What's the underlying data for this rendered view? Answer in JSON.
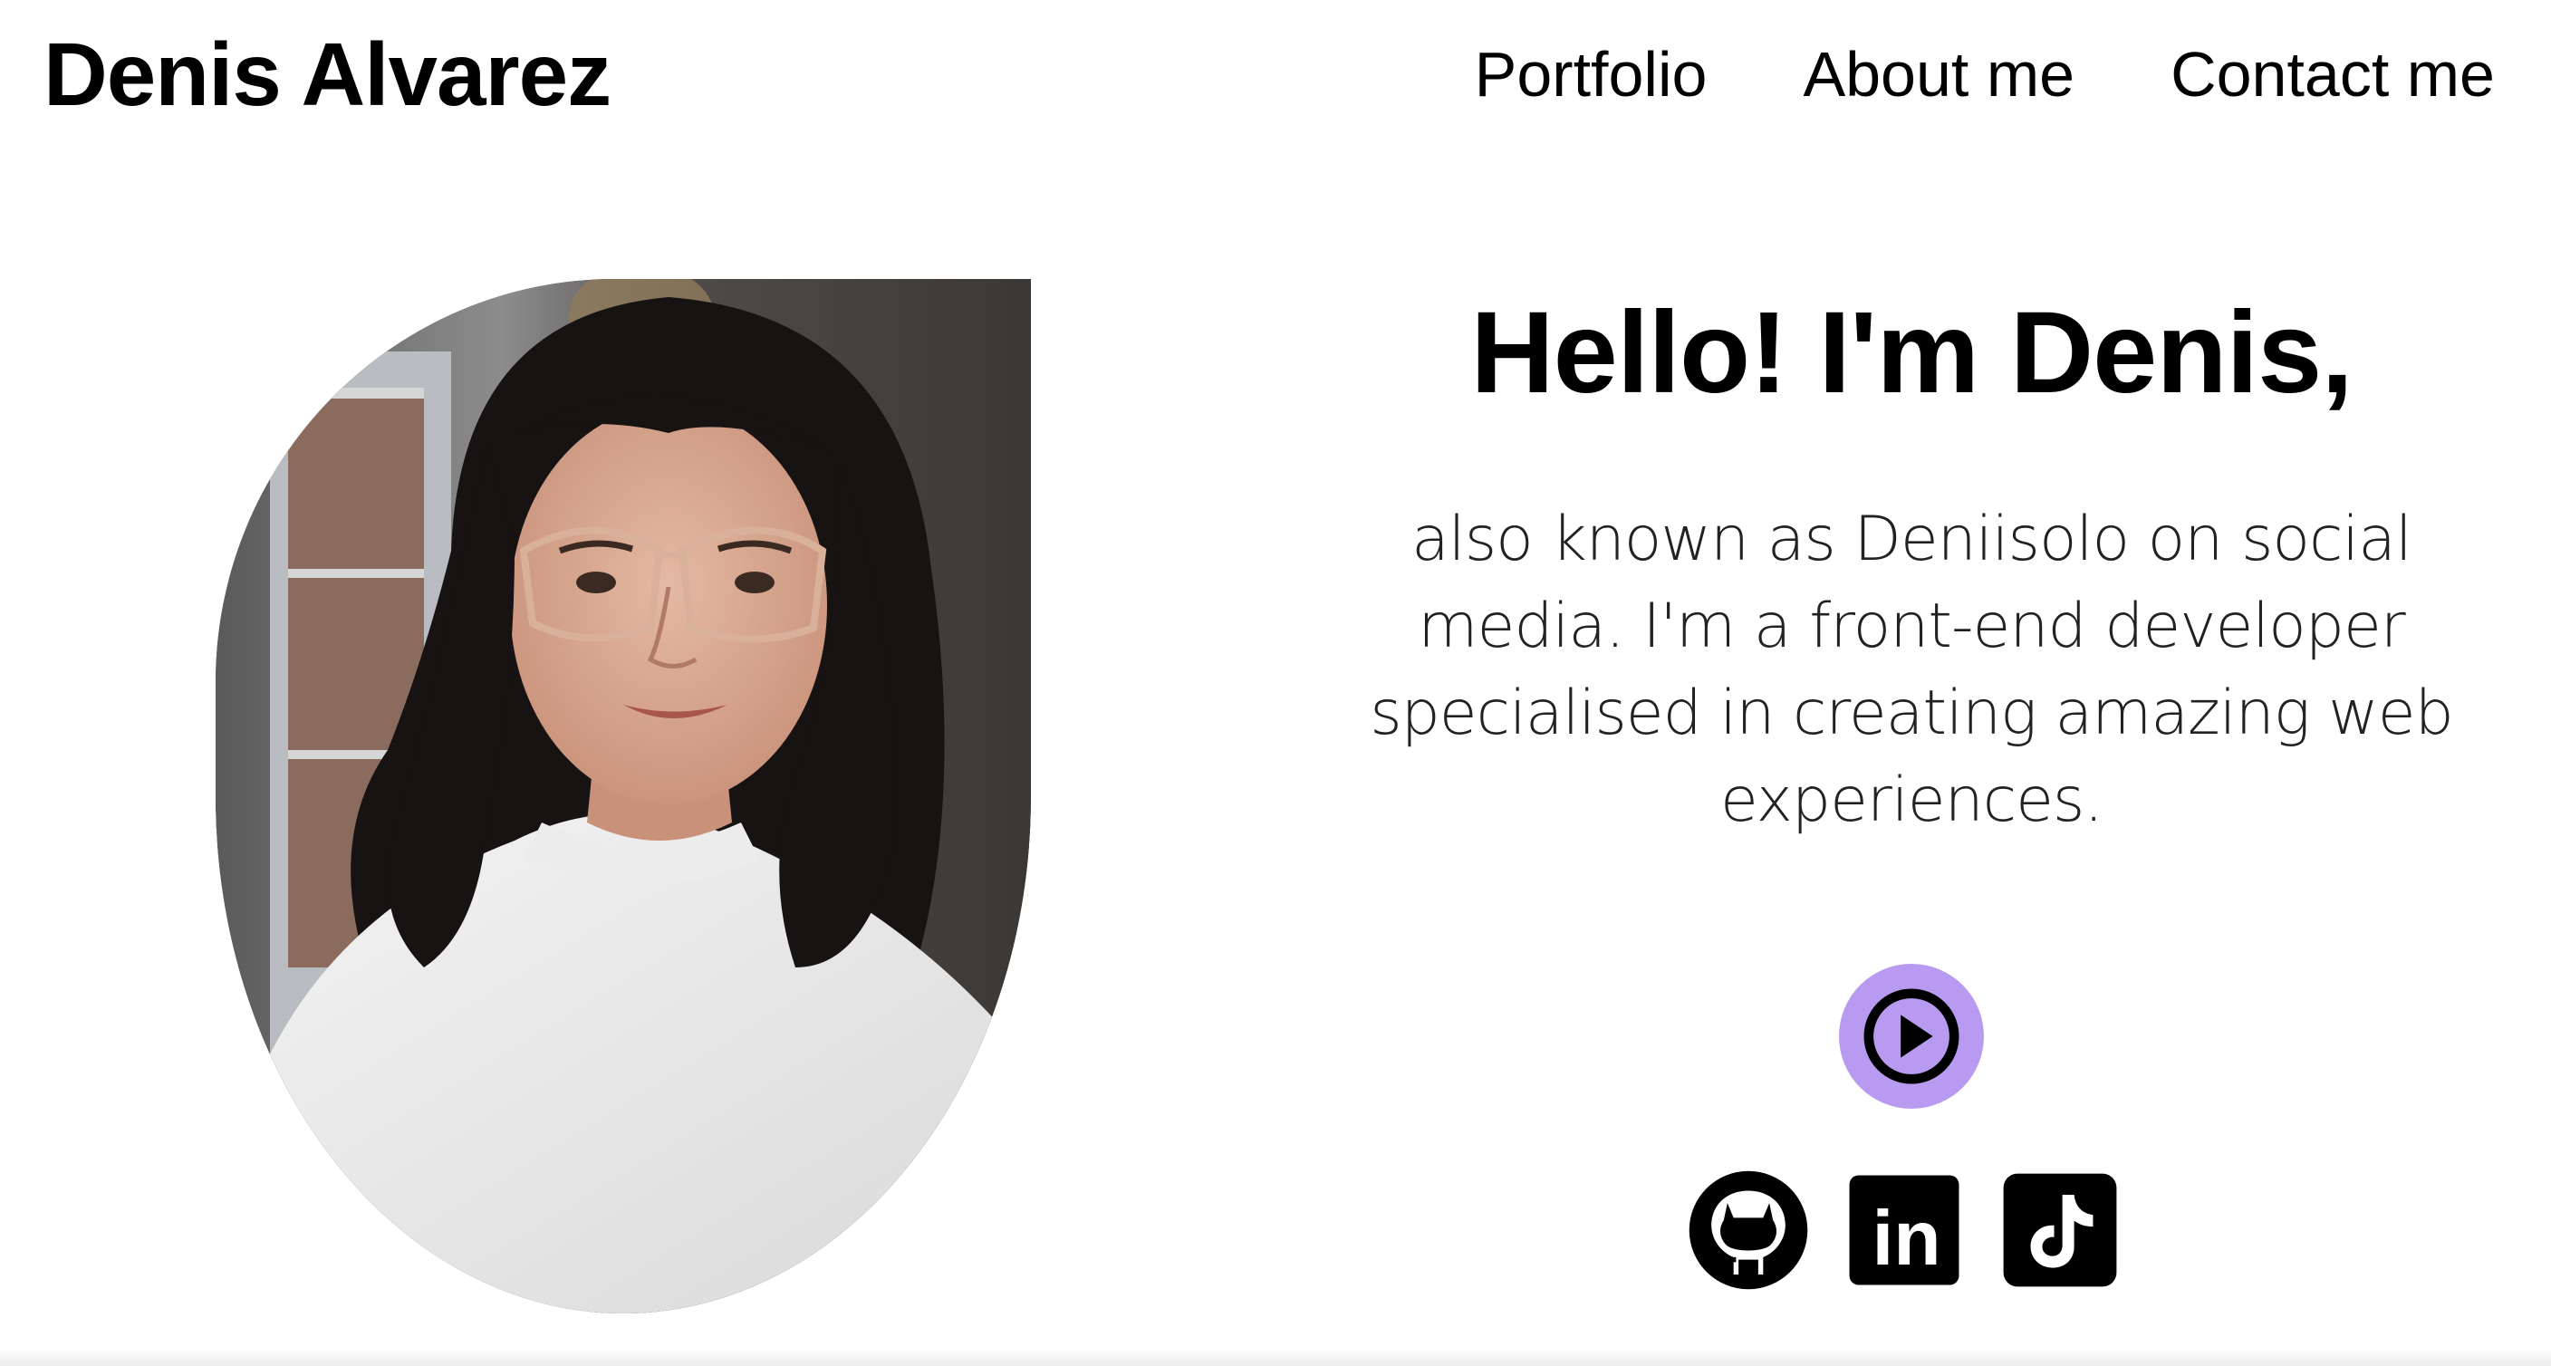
{
  "header": {
    "site_name": "Denis Alvarez",
    "nav": [
      {
        "label": "Portfolio"
      },
      {
        "label": "About me"
      },
      {
        "label": "Contact me"
      }
    ]
  },
  "hero": {
    "title": "Hello! I'm Denis,",
    "description": "also known as Deniisolo on social media. I'm a front-end developer specialised in creating amazing web experiences.",
    "photo_icon": "profile-photo",
    "play_button_icon": "play-icon",
    "accent_color": "#b89af0"
  },
  "socials": [
    {
      "icon": "github-icon"
    },
    {
      "icon": "linkedin-icon",
      "text": "in"
    },
    {
      "icon": "tiktok-icon"
    }
  ]
}
